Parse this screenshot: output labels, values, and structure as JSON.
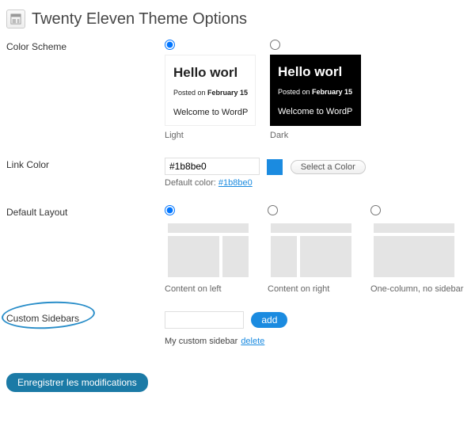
{
  "page_title": "Twenty Eleven Theme Options",
  "labels": {
    "color_scheme": "Color Scheme",
    "link_color": "Link Color",
    "default_layout": "Default Layout",
    "custom_sidebars": "Custom Sidebars"
  },
  "preview": {
    "hello": "Hello worl",
    "posted_prefix": "Posted on ",
    "posted_date": "February 15",
    "welcome": "Welcome to WordP"
  },
  "schemes": {
    "light": "Light",
    "dark": "Dark"
  },
  "link_color": {
    "value": "#1b8be0",
    "select_btn": "Select a Color",
    "default_label": "Default color: ",
    "default_value": "#1b8be0"
  },
  "layouts": {
    "left": "Content on left",
    "right": "Content on right",
    "one": "One-column, no sidebar"
  },
  "custom_sidebars": {
    "add_btn": "add",
    "item_label": "My custom sidebar",
    "delete": "delete"
  },
  "save_btn": "Enregistrer les modifications"
}
